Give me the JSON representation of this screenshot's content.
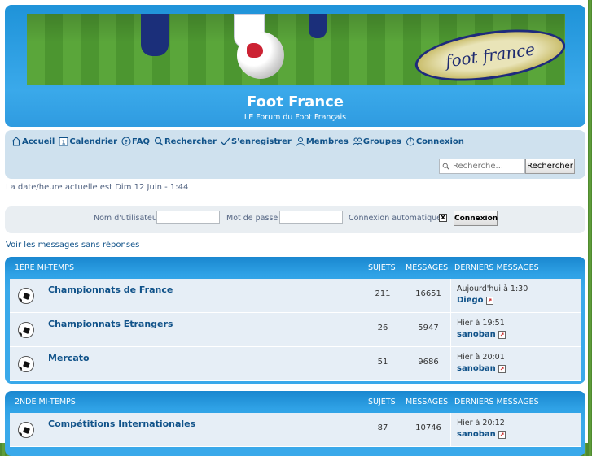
{
  "site": {
    "title": "Foot France",
    "description": "LE Forum du Foot Français",
    "logo_text": "foot france"
  },
  "nav": {
    "items": [
      {
        "label": "Accueil",
        "icon": "home-icon"
      },
      {
        "label": "Calendrier",
        "icon": "calendar-icon"
      },
      {
        "label": "FAQ",
        "icon": "faq-icon"
      },
      {
        "label": "Rechercher",
        "icon": "search-icon"
      },
      {
        "label": "S'enregistrer",
        "icon": "register-icon"
      },
      {
        "label": "Membres",
        "icon": "members-icon"
      },
      {
        "label": "Groupes",
        "icon": "groups-icon"
      },
      {
        "label": "Connexion",
        "icon": "login-icon"
      }
    ],
    "search_placeholder": "Recherche...",
    "search_value": "Recherche...",
    "search_button": "Rechercher"
  },
  "datetime": "La date/heure actuelle est Dim 12 Juin - 1:44",
  "login": {
    "username_label": "Nom d'utilisateur :",
    "password_label": "Mot de passe :",
    "auto_label": "Connexion automatique :",
    "auto_checked": "x",
    "button": "Connexion"
  },
  "unanswered_link": "Voir les messages sans réponses",
  "columns": {
    "topics": "SUJETS",
    "posts": "MESSAGES",
    "last": "DERNIERS MESSAGES"
  },
  "sections": [
    {
      "title": "1ÈRE MI-TEMPS",
      "forums": [
        {
          "name": "Championnats de France",
          "topics": "211",
          "posts": "16651",
          "last_when": "Aujourd'hui à 1:30",
          "last_by": "Diego"
        },
        {
          "name": "Championnats Etrangers",
          "topics": "26",
          "posts": "5947",
          "last_when": "Hier à 19:51",
          "last_by": "sanoban"
        },
        {
          "name": "Mercato",
          "topics": "51",
          "posts": "9686",
          "last_when": "Hier à 20:01",
          "last_by": "sanoban"
        }
      ]
    },
    {
      "title": "2NDE MI-TEMPS",
      "forums": [
        {
          "name": "Compétitions Internationales",
          "topics": "87",
          "posts": "10746",
          "last_when": "Hier à 20:12",
          "last_by": "sanoban"
        }
      ]
    }
  ]
}
